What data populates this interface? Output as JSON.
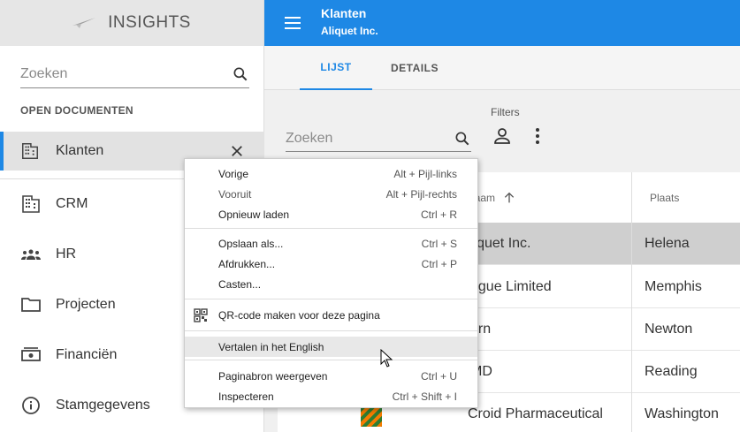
{
  "sidebar": {
    "app_name": "INSIGHTS",
    "search_placeholder": "Zoeken",
    "section_title": "OPEN DOCUMENTEN",
    "open_document": "Klanten",
    "items": [
      {
        "label": "CRM",
        "icon": "building-icon"
      },
      {
        "label": "HR",
        "icon": "people-icon"
      },
      {
        "label": "Projecten",
        "icon": "folder-icon"
      },
      {
        "label": "Financiën",
        "icon": "money-icon"
      },
      {
        "label": "Stamgegevens",
        "icon": "info-icon"
      }
    ]
  },
  "header": {
    "title": "Klanten",
    "subtitle": "Aliquet Inc."
  },
  "tabs": [
    {
      "label": "LIJST",
      "active": true
    },
    {
      "label": "DETAILS",
      "active": false
    }
  ],
  "filters": {
    "label": "Filters",
    "search_placeholder": "Zoeken"
  },
  "table": {
    "columns": [
      "laam",
      "Plaats"
    ],
    "rows": [
      {
        "name": "liquet Inc.",
        "place": "Helena",
        "selected": true
      },
      {
        "name": "ugue Limited",
        "place": "Memphis"
      },
      {
        "name": "arn",
        "place": "Newton"
      },
      {
        "name": "MD",
        "place": "Reading"
      },
      {
        "name": "Croid Pharmaceutical",
        "place": "Washington"
      }
    ]
  },
  "context_menu": {
    "groups": [
      [
        {
          "label": "Vorige",
          "shortcut": "Alt + Pijl-links"
        },
        {
          "label": "Vooruit",
          "shortcut": "Alt + Pijl-rechts",
          "disabled": true
        },
        {
          "label": "Opnieuw laden",
          "shortcut": "Ctrl + R"
        }
      ],
      [
        {
          "label": "Opslaan als...",
          "shortcut": "Ctrl + S"
        },
        {
          "label": "Afdrukken...",
          "shortcut": "Ctrl + P"
        },
        {
          "label": "Casten...",
          "shortcut": ""
        }
      ],
      [
        {
          "label": "QR-code maken voor deze pagina",
          "shortcut": "",
          "icon": "qr-code-icon"
        }
      ],
      [
        {
          "label": "Vertalen in het English",
          "shortcut": "",
          "hover": true
        }
      ],
      [
        {
          "label": "Paginabron weergeven",
          "shortcut": "Ctrl + U"
        },
        {
          "label": "Inspecteren",
          "shortcut": "Ctrl + Shift + I"
        }
      ]
    ]
  },
  "colors": {
    "accent": "#1e88e5",
    "selected_row": "#cfcfcf",
    "menu_hover": "#e8e8e8"
  }
}
